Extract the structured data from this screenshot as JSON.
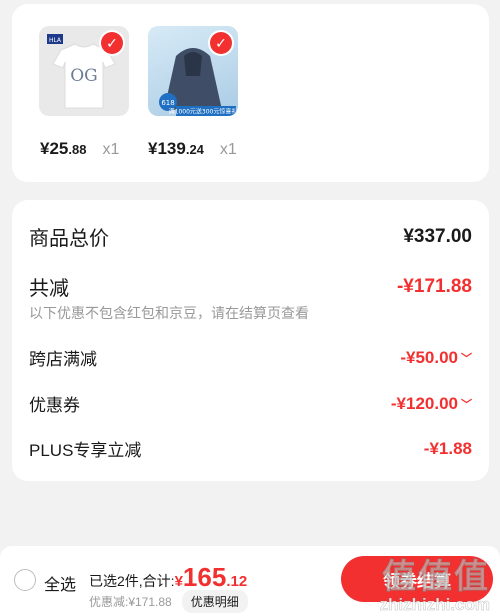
{
  "products": [
    {
      "thumb": "tshirt",
      "currency": "¥",
      "price_int": "25",
      "price_dec": ".88",
      "qty": "x1",
      "selected": true,
      "brand_tag": "HLA",
      "logo_text": "OG"
    },
    {
      "thumb": "jacket",
      "currency": "¥",
      "price_int": "139",
      "price_dec": ".24",
      "qty": "x1",
      "selected": true,
      "badge": "618",
      "banner": "满1000元送300元惊喜礼券"
    }
  ],
  "summary": {
    "total_label": "商品总价",
    "total_value": "¥337.00",
    "reduce_label": "共减",
    "reduce_value": "-¥171.88",
    "note": "以下优惠不包含红包和京豆，请在结算页查看",
    "rows": [
      {
        "label": "跨店满减",
        "value": "-¥50.00",
        "expandable": true
      },
      {
        "label": "优惠券",
        "value": "-¥120.00",
        "expandable": true
      },
      {
        "label": "PLUS专享立减",
        "value": "-¥1.88",
        "expandable": false
      }
    ]
  },
  "bottom_bar": {
    "select_all": "全选",
    "selected_text": "已选2件,合计:",
    "currency": "¥",
    "total_int": "165",
    "total_dec": ".12",
    "discount_text": "优惠减:¥171.88",
    "detail_button": "优惠明细",
    "checkout_button": "领券结算"
  },
  "watermark": {
    "big": "值值值",
    "small": "zhizhizhi.com"
  },
  "colors": {
    "accent": "#f23030",
    "muted": "#999999",
    "background": "#f2f2f2"
  }
}
